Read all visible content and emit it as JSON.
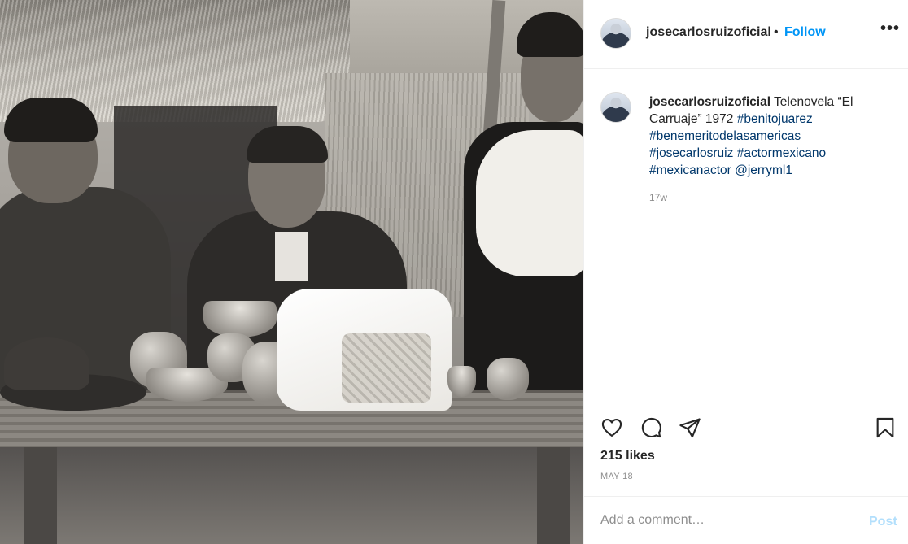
{
  "header": {
    "username": "josecarlosruizoficial",
    "separator": "•",
    "follow_label": "Follow",
    "more_label": "•••"
  },
  "caption": {
    "username": "josecarlosruizoficial",
    "text": " Telenovela “El Carruaje” 1972 ",
    "hashtags": [
      "#benitojuarez",
      "#benemeritodelasamericas",
      "#josecarlosruiz",
      "#actormexicano",
      "#mexicanactor"
    ],
    "mention": "@jerryml1",
    "time_ago": "17w"
  },
  "actions": {
    "icons": [
      "heart-icon",
      "comment-icon",
      "share-icon",
      "bookmark-icon"
    ]
  },
  "likes_label": "215 likes",
  "post_date": "MAY 18",
  "comment": {
    "placeholder": "Add a comment…",
    "value": "",
    "post_label": "Post"
  },
  "colors": {
    "link": "#0095f6",
    "hashtag": "#00376b",
    "muted": "#8e8e8e",
    "post_disabled": "#b2dffc",
    "text": "#262626"
  }
}
